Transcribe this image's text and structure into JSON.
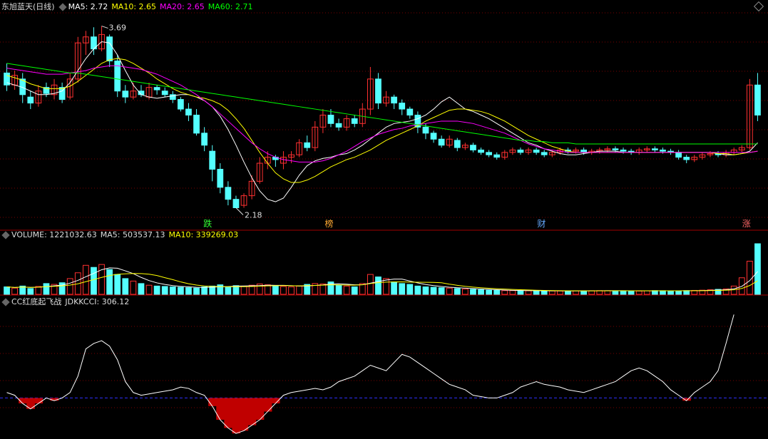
{
  "colors": {
    "up": "#ff3030",
    "down": "#54ffff",
    "ma5": "#ffffff",
    "ma10": "#ffff00",
    "ma20": "#ff00ff",
    "ma60": "#00ff00",
    "grid": "#7a0000",
    "zero": "#3030ff",
    "cci_neg": "#c00000",
    "text": "#dddddd"
  },
  "price_header": {
    "name": "东旭蓝天(日线)",
    "ma5": "MA5: 2.72",
    "ma10": "MA10: 2.65",
    "ma20": "MA20: 2.65",
    "ma60": "MA60: 2.71"
  },
  "volume_header": {
    "vol": "VOLUME: 1221032.63",
    "ma5": "MA5: 503537.13",
    "ma10": "MA10: 339269.03"
  },
  "cci_header": {
    "name": "CC红底起飞战",
    "value": "JDKKCCI: 306.12"
  },
  "annotations": {
    "high": "3.69",
    "low": "2.18"
  },
  "markers": [
    {
      "label": "跌",
      "color": "#33ff33"
    },
    {
      "label": "榜",
      "color": "#ffaa33"
    },
    {
      "label": "财",
      "color": "#66aaff"
    },
    {
      "label": "涨",
      "color": "#ff6666"
    }
  ],
  "chart_data": [
    {
      "type": "candlestick",
      "title": "东旭蓝天(日线)",
      "ylim": [
        2.1,
        3.8
      ],
      "series": [
        {
          "name": "MA5",
          "values": [
            3.22,
            3.2,
            3.18,
            3.15,
            3.12,
            3.12,
            3.13,
            3.15,
            3.22,
            3.32,
            3.42,
            3.5,
            3.56,
            3.55,
            3.45,
            3.32,
            3.2,
            3.12,
            3.1,
            3.09,
            3.1,
            3.11,
            3.12,
            3.12,
            3.1,
            3.07,
            3.02,
            2.94,
            2.83,
            2.7,
            2.56,
            2.43,
            2.32,
            2.25,
            2.23,
            2.26,
            2.35,
            2.45,
            2.53,
            2.57,
            2.59,
            2.6,
            2.62,
            2.63,
            2.66,
            2.7,
            2.75,
            2.8,
            2.85,
            2.88,
            2.89,
            2.9,
            2.92,
            2.95,
            3.0,
            3.06,
            3.1,
            3.05,
            3.0,
            2.98,
            2.95,
            2.92,
            2.88,
            2.84,
            2.8,
            2.76,
            2.72,
            2.7,
            2.67,
            2.65,
            2.63,
            2.62,
            2.62,
            2.63,
            2.64,
            2.65,
            2.65,
            2.65,
            2.64,
            2.64,
            2.64,
            2.64,
            2.64,
            2.64,
            2.64,
            2.64,
            2.64,
            2.64,
            2.64,
            2.64,
            2.63,
            2.62,
            2.62,
            2.63,
            2.65,
            2.72
          ]
        },
        {
          "name": "MA10",
          "values": [
            3.28,
            3.26,
            3.24,
            3.21,
            3.19,
            3.17,
            3.17,
            3.17,
            3.19,
            3.23,
            3.28,
            3.33,
            3.38,
            3.41,
            3.42,
            3.41,
            3.38,
            3.34,
            3.3,
            3.25,
            3.21,
            3.17,
            3.14,
            3.12,
            3.1,
            3.09,
            3.07,
            3.04,
            2.99,
            2.92,
            2.84,
            2.74,
            2.64,
            2.55,
            2.47,
            2.42,
            2.39,
            2.39,
            2.41,
            2.44,
            2.48,
            2.52,
            2.55,
            2.58,
            2.6,
            2.63,
            2.66,
            2.7,
            2.74,
            2.77,
            2.8,
            2.83,
            2.86,
            2.9,
            2.93,
            2.96,
            2.99,
            3.0,
            3.0,
            2.99,
            2.98,
            2.96,
            2.93,
            2.9,
            2.86,
            2.82,
            2.78,
            2.75,
            2.72,
            2.69,
            2.67,
            2.65,
            2.64,
            2.64,
            2.64,
            2.64,
            2.64,
            2.64,
            2.64,
            2.64,
            2.64,
            2.64,
            2.64,
            2.64,
            2.64,
            2.64,
            2.64,
            2.64,
            2.64,
            2.64,
            2.63,
            2.63,
            2.62,
            2.63,
            2.64,
            2.65
          ]
        },
        {
          "name": "MA20",
          "values": [
            3.34,
            3.33,
            3.32,
            3.31,
            3.3,
            3.29,
            3.29,
            3.29,
            3.3,
            3.31,
            3.32,
            3.34,
            3.35,
            3.36,
            3.36,
            3.35,
            3.34,
            3.33,
            3.31,
            3.29,
            3.26,
            3.23,
            3.2,
            3.16,
            3.12,
            3.07,
            3.02,
            2.96,
            2.9,
            2.84,
            2.78,
            2.72,
            2.67,
            2.63,
            2.6,
            2.58,
            2.57,
            2.56,
            2.56,
            2.56,
            2.57,
            2.59,
            2.62,
            2.65,
            2.69,
            2.73,
            2.76,
            2.79,
            2.81,
            2.83,
            2.84,
            2.86,
            2.87,
            2.88,
            2.89,
            2.9,
            2.9,
            2.9,
            2.89,
            2.88,
            2.86,
            2.84,
            2.82,
            2.8,
            2.77,
            2.74,
            2.71,
            2.69,
            2.67,
            2.66,
            2.65,
            2.64,
            2.64,
            2.64,
            2.64,
            2.64,
            2.64,
            2.64,
            2.64,
            2.64,
            2.64,
            2.64,
            2.64,
            2.64,
            2.64,
            2.64,
            2.64,
            2.64,
            2.64,
            2.64,
            2.64,
            2.64,
            2.64,
            2.64,
            2.64,
            2.65
          ]
        },
        {
          "name": "MA60",
          "values": [
            3.38,
            3.37,
            3.36,
            3.35,
            3.34,
            3.33,
            3.32,
            3.31,
            3.3,
            3.3,
            3.29,
            3.28,
            3.27,
            3.26,
            3.25,
            3.24,
            3.23,
            3.22,
            3.21,
            3.2,
            3.19,
            3.18,
            3.17,
            3.16,
            3.15,
            3.14,
            3.13,
            3.12,
            3.11,
            3.1,
            3.09,
            3.08,
            3.07,
            3.06,
            3.05,
            3.04,
            3.03,
            3.02,
            3.01,
            3.0,
            2.99,
            2.98,
            2.97,
            2.96,
            2.95,
            2.94,
            2.93,
            2.92,
            2.91,
            2.9,
            2.89,
            2.88,
            2.87,
            2.86,
            2.85,
            2.84,
            2.83,
            2.82,
            2.81,
            2.8,
            2.79,
            2.78,
            2.77,
            2.76,
            2.75,
            2.74,
            2.74,
            2.73,
            2.73,
            2.72,
            2.72,
            2.72,
            2.71,
            2.71,
            2.71,
            2.71,
            2.71,
            2.71,
            2.71,
            2.71,
            2.71,
            2.71,
            2.71,
            2.71,
            2.71,
            2.71,
            2.71,
            2.71,
            2.71,
            2.71,
            2.71,
            2.71,
            2.71,
            2.71,
            2.71,
            2.71
          ]
        }
      ],
      "candles": [
        [
          3.3,
          3.2,
          3.38,
          3.15
        ],
        [
          3.2,
          3.28,
          3.32,
          3.16
        ],
        [
          3.25,
          3.12,
          3.3,
          3.05
        ],
        [
          3.1,
          3.05,
          3.15,
          3.0
        ],
        [
          3.05,
          3.15,
          3.2,
          3.02
        ],
        [
          3.18,
          3.13,
          3.22,
          3.1
        ],
        [
          3.12,
          3.2,
          3.25,
          3.08
        ],
        [
          3.18,
          3.08,
          3.22,
          3.05
        ],
        [
          3.1,
          3.25,
          3.3,
          3.08
        ],
        [
          3.25,
          3.55,
          3.6,
          3.22
        ],
        [
          3.55,
          3.6,
          3.65,
          3.45
        ],
        [
          3.6,
          3.5,
          3.68,
          3.45
        ],
        [
          3.5,
          3.62,
          3.69,
          3.48
        ],
        [
          3.6,
          3.4,
          3.62,
          3.35
        ],
        [
          3.4,
          3.15,
          3.45,
          3.1
        ],
        [
          3.15,
          3.1,
          3.2,
          3.05
        ],
        [
          3.1,
          3.15,
          3.22,
          3.08
        ],
        [
          3.15,
          3.12,
          3.2,
          3.1
        ],
        [
          3.1,
          3.18,
          3.22,
          3.08
        ],
        [
          3.18,
          3.16,
          3.2,
          3.12
        ],
        [
          3.15,
          3.12,
          3.18,
          3.1
        ],
        [
          3.12,
          3.08,
          3.15,
          3.05
        ],
        [
          3.08,
          3.0,
          3.1,
          2.98
        ],
        [
          3.0,
          2.95,
          3.05,
          2.9
        ],
        [
          2.95,
          2.8,
          3.0,
          2.78
        ],
        [
          2.8,
          2.7,
          2.85,
          2.65
        ],
        [
          2.65,
          2.5,
          2.7,
          2.4
        ],
        [
          2.5,
          2.35,
          2.55,
          2.3
        ],
        [
          2.35,
          2.25,
          2.4,
          2.2
        ],
        [
          2.25,
          2.18,
          2.28,
          2.18
        ],
        [
          2.2,
          2.28,
          2.3,
          2.18
        ],
        [
          2.28,
          2.4,
          2.45,
          2.25
        ],
        [
          2.4,
          2.55,
          2.6,
          2.38
        ],
        [
          2.55,
          2.6,
          2.65,
          2.5
        ],
        [
          2.6,
          2.58,
          2.62,
          2.52
        ],
        [
          2.55,
          2.6,
          2.65,
          2.5
        ],
        [
          2.6,
          2.62,
          2.65,
          2.55
        ],
        [
          2.62,
          2.72,
          2.75,
          2.6
        ],
        [
          2.72,
          2.68,
          2.78,
          2.65
        ],
        [
          2.68,
          2.85,
          2.9,
          2.65
        ],
        [
          2.85,
          2.95,
          3.0,
          2.8
        ],
        [
          2.95,
          2.88,
          3.0,
          2.85
        ],
        [
          2.88,
          2.85,
          2.92,
          2.82
        ],
        [
          2.85,
          2.92,
          2.95,
          2.82
        ],
        [
          2.92,
          2.88,
          2.95,
          2.85
        ],
        [
          2.88,
          3.0,
          3.05,
          2.85
        ],
        [
          3.0,
          3.25,
          3.35,
          2.95
        ],
        [
          3.25,
          3.05,
          3.3,
          3.0
        ],
        [
          3.05,
          3.1,
          3.15,
          3.02
        ],
        [
          3.1,
          3.05,
          3.12,
          3.0
        ],
        [
          3.05,
          3.0,
          3.08,
          2.95
        ],
        [
          3.0,
          2.95,
          3.02,
          2.92
        ],
        [
          2.95,
          2.85,
          2.98,
          2.8
        ],
        [
          2.85,
          2.8,
          2.88,
          2.75
        ],
        [
          2.8,
          2.75,
          2.82,
          2.72
        ],
        [
          2.75,
          2.7,
          2.78,
          2.68
        ],
        [
          2.7,
          2.75,
          2.78,
          2.68
        ],
        [
          2.74,
          2.68,
          2.76,
          2.65
        ],
        [
          2.68,
          2.7,
          2.72,
          2.66
        ],
        [
          2.7,
          2.66,
          2.72,
          2.64
        ],
        [
          2.66,
          2.64,
          2.68,
          2.62
        ],
        [
          2.64,
          2.62,
          2.66,
          2.6
        ],
        [
          2.62,
          2.6,
          2.64,
          2.58
        ],
        [
          2.6,
          2.64,
          2.66,
          2.58
        ],
        [
          2.64,
          2.66,
          2.68,
          2.62
        ],
        [
          2.66,
          2.64,
          2.68,
          2.62
        ],
        [
          2.64,
          2.66,
          2.68,
          2.62
        ],
        [
          2.66,
          2.64,
          2.68,
          2.62
        ],
        [
          2.64,
          2.62,
          2.66,
          2.6
        ],
        [
          2.62,
          2.64,
          2.66,
          2.6
        ],
        [
          2.64,
          2.66,
          2.68,
          2.62
        ],
        [
          2.66,
          2.65,
          2.68,
          2.63
        ],
        [
          2.65,
          2.66,
          2.68,
          2.63
        ],
        [
          2.66,
          2.64,
          2.68,
          2.62
        ],
        [
          2.64,
          2.65,
          2.67,
          2.62
        ],
        [
          2.65,
          2.66,
          2.68,
          2.63
        ],
        [
          2.66,
          2.67,
          2.69,
          2.64
        ],
        [
          2.67,
          2.66,
          2.69,
          2.64
        ],
        [
          2.66,
          2.65,
          2.68,
          2.63
        ],
        [
          2.65,
          2.64,
          2.67,
          2.62
        ],
        [
          2.64,
          2.66,
          2.68,
          2.62
        ],
        [
          2.66,
          2.67,
          2.69,
          2.64
        ],
        [
          2.67,
          2.66,
          2.69,
          2.64
        ],
        [
          2.66,
          2.65,
          2.68,
          2.63
        ],
        [
          2.65,
          2.64,
          2.67,
          2.62
        ],
        [
          2.64,
          2.6,
          2.66,
          2.58
        ],
        [
          2.6,
          2.58,
          2.62,
          2.55
        ],
        [
          2.58,
          2.6,
          2.62,
          2.56
        ],
        [
          2.6,
          2.62,
          2.64,
          2.58
        ],
        [
          2.62,
          2.63,
          2.65,
          2.6
        ],
        [
          2.63,
          2.62,
          2.65,
          2.6
        ],
        [
          2.62,
          2.64,
          2.66,
          2.6
        ],
        [
          2.64,
          2.66,
          2.68,
          2.62
        ],
        [
          2.66,
          2.68,
          2.7,
          2.64
        ],
        [
          2.68,
          3.2,
          3.25,
          2.66
        ],
        [
          3.2,
          2.95,
          3.3,
          2.9
        ]
      ]
    },
    {
      "type": "bar",
      "title": "VOLUME",
      "values": [
        180,
        150,
        200,
        140,
        190,
        260,
        240,
        280,
        380,
        520,
        700,
        650,
        720,
        600,
        480,
        380,
        320,
        260,
        220,
        200,
        190,
        180,
        170,
        160,
        150,
        180,
        200,
        230,
        180,
        210,
        190,
        220,
        250,
        230,
        200,
        190,
        180,
        200,
        240,
        260,
        250,
        300,
        220,
        200,
        180,
        260,
        480,
        420,
        380,
        300,
        260,
        240,
        200,
        180,
        170,
        160,
        150,
        140,
        130,
        120,
        110,
        100,
        95,
        90,
        90,
        88,
        85,
        85,
        84,
        82,
        80,
        82,
        84,
        86,
        88,
        90,
        88,
        86,
        84,
        82,
        80,
        85,
        90,
        88,
        86,
        84,
        90,
        95,
        100,
        110,
        120,
        130,
        200,
        400,
        800,
        1221
      ]
    },
    {
      "type": "line",
      "title": "JDKKCCI",
      "ylim": [
        -140,
        320
      ],
      "values": [
        20,
        10,
        -20,
        -40,
        -20,
        0,
        -10,
        0,
        20,
        80,
        180,
        200,
        210,
        190,
        140,
        60,
        20,
        10,
        15,
        20,
        25,
        30,
        40,
        35,
        20,
        10,
        -30,
        -80,
        -110,
        -130,
        -120,
        -100,
        -80,
        -50,
        -20,
        10,
        20,
        25,
        30,
        35,
        30,
        40,
        60,
        70,
        80,
        100,
        120,
        110,
        100,
        130,
        160,
        150,
        130,
        110,
        90,
        70,
        50,
        40,
        30,
        10,
        5,
        0,
        0,
        10,
        20,
        40,
        50,
        60,
        50,
        45,
        40,
        30,
        25,
        20,
        30,
        40,
        50,
        60,
        80,
        100,
        110,
        100,
        80,
        60,
        30,
        10,
        -10,
        20,
        40,
        60,
        100,
        200,
        306
      ]
    }
  ]
}
